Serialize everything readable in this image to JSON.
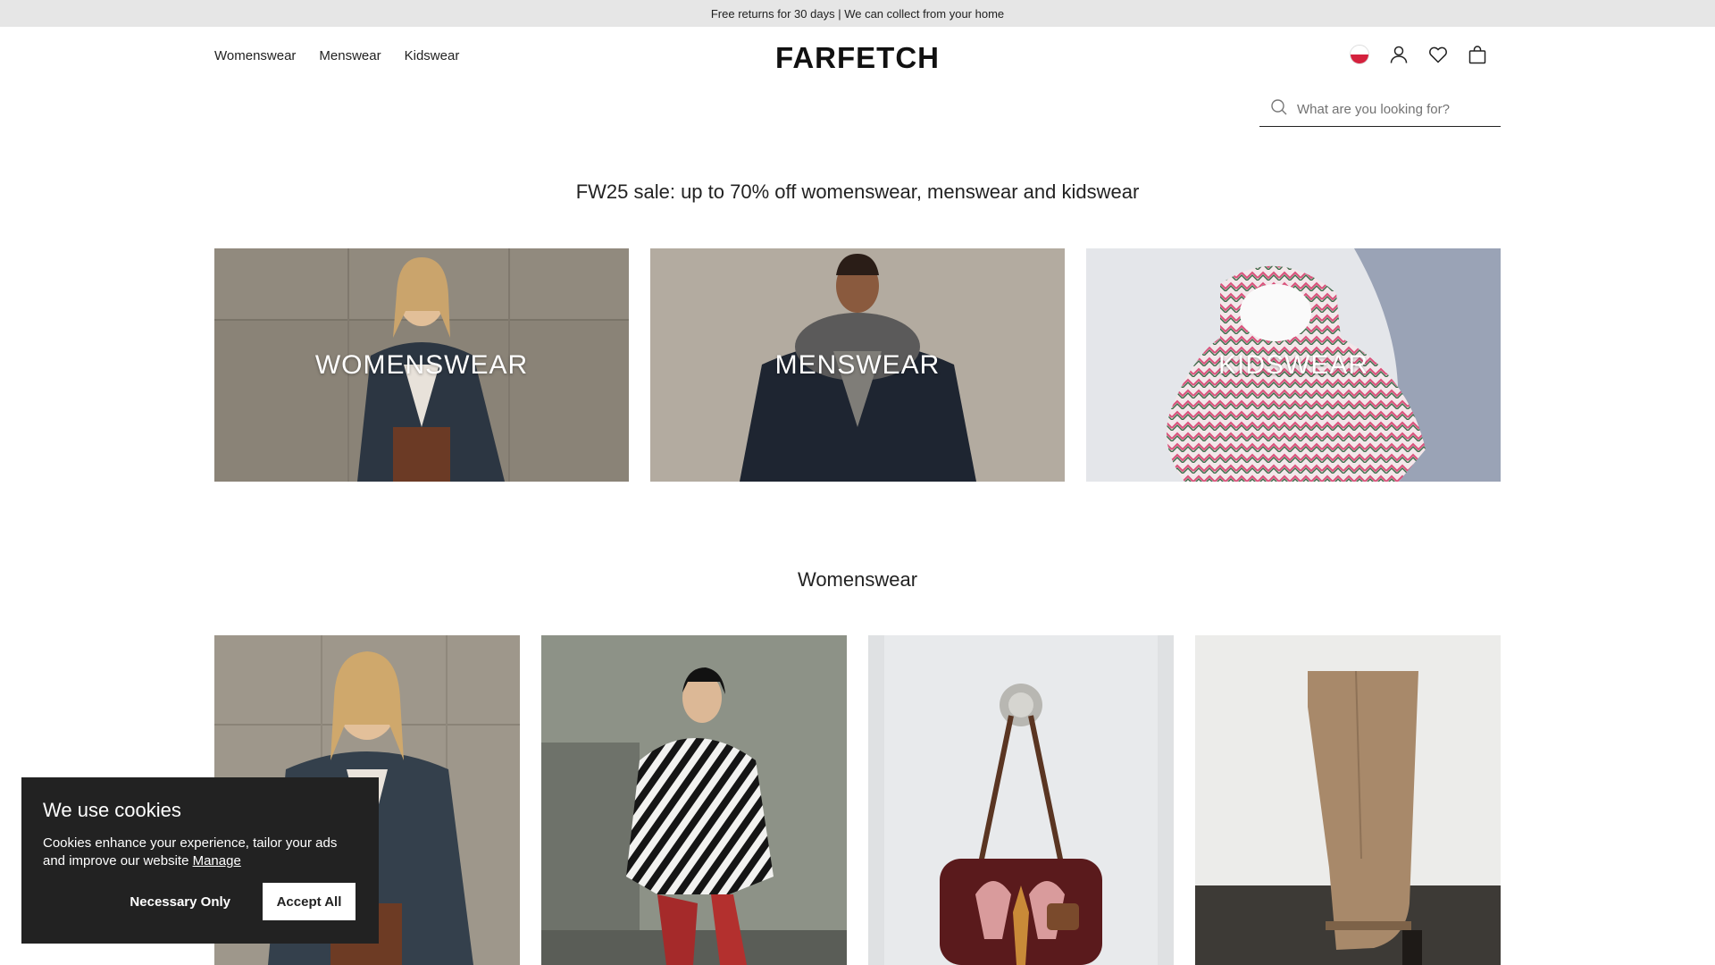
{
  "promo": {
    "text": "Free returns for 30 days | We can collect from your home"
  },
  "nav": {
    "items": [
      "Womenswear",
      "Menswear",
      "Kidswear"
    ]
  },
  "brand": {
    "logo": "FARFETCH"
  },
  "header_icons": [
    "poland-flag-icon",
    "account-icon",
    "wishlist-heart-icon",
    "shopping-bag-icon"
  ],
  "search": {
    "placeholder": "What are you looking for?"
  },
  "sale": {
    "heading": "FW25 sale: up to 70% off womenswear, menswear and kidswear"
  },
  "categories": [
    {
      "label": "WOMENSWEAR"
    },
    {
      "label": "MENSWEAR"
    },
    {
      "label": "KIDSWEAR"
    }
  ],
  "section": {
    "title": "Womenswear"
  },
  "products": [
    {
      "name": "product-image-coat"
    },
    {
      "name": "product-image-striped-dress"
    },
    {
      "name": "product-image-handbag"
    },
    {
      "name": "product-image-suede-boot"
    }
  ],
  "cookie": {
    "title": "We use cookies",
    "body": "Cookies enhance your experience, tailor your ads and improve our website",
    "manage": "Manage",
    "necessary": "Necessary Only",
    "accept": "Accept All"
  },
  "colors": {
    "flag_red": "#d4213d",
    "cookie_bg": "#222222",
    "promo_bg": "#e6e6e6"
  }
}
